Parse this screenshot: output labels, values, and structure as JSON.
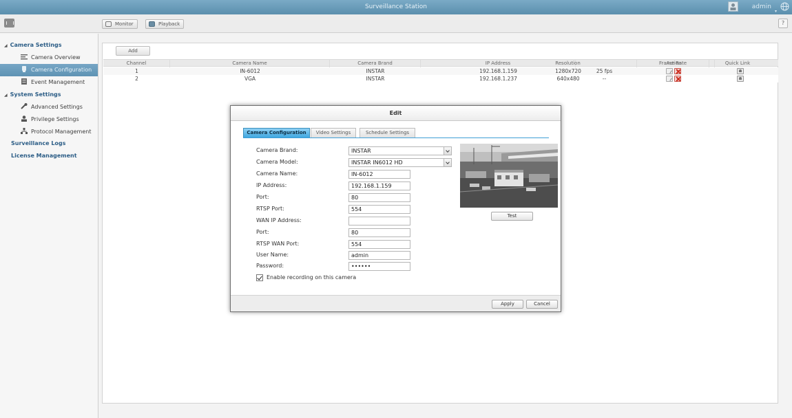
{
  "app": {
    "title": "Surveillance Station",
    "user": "admin"
  },
  "toolbar": {
    "monitor_label": "Monitor",
    "playback_label": "Playback",
    "help_label": "?"
  },
  "sidebar": {
    "items": [
      {
        "label": "Camera Settings",
        "type": "head"
      },
      {
        "label": "Camera Overview",
        "type": "child"
      },
      {
        "label": "Camera Configuration",
        "type": "child",
        "selected": true
      },
      {
        "label": "Event Management",
        "type": "child"
      },
      {
        "label": "System Settings",
        "type": "head"
      },
      {
        "label": "Advanced Settings",
        "type": "child"
      },
      {
        "label": "Privilege Settings",
        "type": "child"
      },
      {
        "label": "Protocol Management",
        "type": "child"
      },
      {
        "label": "Surveillance Logs",
        "type": "top"
      },
      {
        "label": "License Management",
        "type": "top"
      }
    ]
  },
  "list": {
    "add_label": "Add",
    "columns": [
      "Channel",
      "Camera Name",
      "Camera Brand",
      "IP Address",
      "Resolution",
      "Frame Rate",
      "Action",
      "Quick Link"
    ],
    "rows": [
      {
        "channel": "1",
        "name": "IN-6012",
        "brand": "INSTAR",
        "ip": "192.168.1.159",
        "resolution": "1280x720",
        "frame_rate": "25 fps"
      },
      {
        "channel": "2",
        "name": "VGA",
        "brand": "INSTAR",
        "ip": "192.168.1.237",
        "resolution": "640x480",
        "frame_rate": "--"
      }
    ]
  },
  "dialog": {
    "title": "Edit",
    "tabs": [
      "Camera Configuration",
      "Video Settings",
      "Schedule Settings"
    ],
    "fields": {
      "brand": {
        "label": "Camera Brand:",
        "value": "INSTAR"
      },
      "model": {
        "label": "Camera Model:",
        "value": "INSTAR IN6012 HD"
      },
      "name": {
        "label": "Camera Name:",
        "value": "IN-6012"
      },
      "ip": {
        "label": "IP Address:",
        "value": "192.168.1.159"
      },
      "port": {
        "label": "Port:",
        "value": "80"
      },
      "rtsp_port": {
        "label": "RTSP Port:",
        "value": "554"
      },
      "wan_ip": {
        "label": "WAN IP Address:",
        "value": ""
      },
      "wan_port": {
        "label": "Port:",
        "value": "80"
      },
      "rtsp_wan_port": {
        "label": "RTSP WAN Port:",
        "value": "554"
      },
      "user": {
        "label": "User Name:",
        "value": "admin"
      },
      "password": {
        "label": "Password:",
        "value": "••••••"
      }
    },
    "enable_recording": {
      "label": "Enable recording on this camera",
      "checked": true
    },
    "test_label": "Test",
    "apply_label": "Apply",
    "cancel_label": "Cancel"
  },
  "colors": {
    "titlebar": "#6b9dbb",
    "selected": "#6a9dbd",
    "active_tab": "#3fa7e0",
    "delete_red": "#cc2b1d"
  }
}
